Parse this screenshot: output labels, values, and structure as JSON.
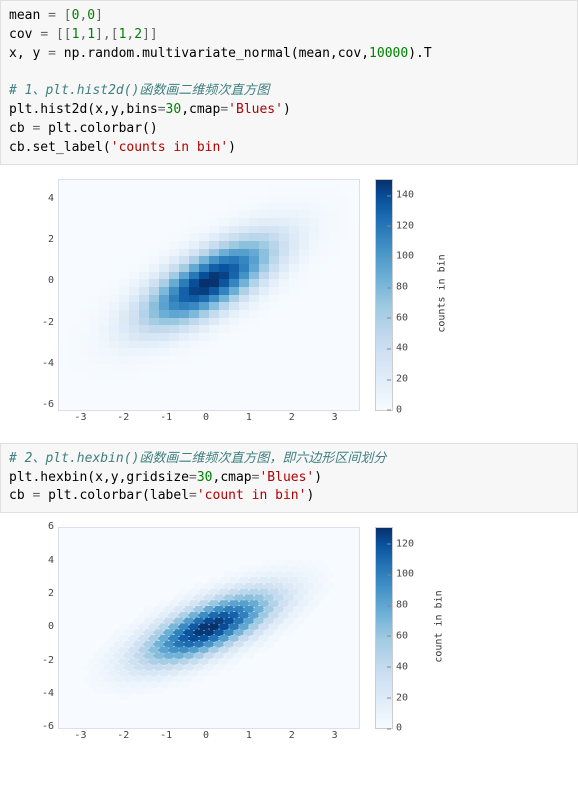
{
  "code_block_1": {
    "lines": [
      [
        [
          "mean ",
          "name"
        ],
        [
          "= ",
          "op"
        ],
        [
          "[",
          "op"
        ],
        [
          "0",
          "num"
        ],
        [
          ",",
          "op"
        ],
        [
          "0",
          "num"
        ],
        [
          "]",
          "op"
        ]
      ],
      [
        [
          "cov ",
          "name"
        ],
        [
          "= ",
          "op"
        ],
        [
          "[[",
          "op"
        ],
        [
          "1",
          "num"
        ],
        [
          ",",
          "op"
        ],
        [
          "1",
          "num"
        ],
        [
          "],[",
          "op"
        ],
        [
          "1",
          "num"
        ],
        [
          ",",
          "op"
        ],
        [
          "2",
          "num"
        ],
        [
          "]]",
          "op"
        ]
      ],
      [
        [
          "x, y ",
          "name"
        ],
        [
          "= ",
          "op"
        ],
        [
          "np.random.multivariate_normal(mean,cov,",
          "name"
        ],
        [
          "10000",
          "num"
        ],
        [
          ").T",
          "name"
        ]
      ],
      [
        [
          "",
          "name"
        ]
      ],
      [
        [
          "# 1、plt.hist2d()函数画二维频次直方图",
          "com"
        ]
      ],
      [
        [
          "plt.hist2d(x,y,bins",
          "name"
        ],
        [
          "=",
          "op"
        ],
        [
          "30",
          "num"
        ],
        [
          ",cmap",
          "name"
        ],
        [
          "=",
          "op"
        ],
        [
          "'Blues'",
          "str"
        ],
        [
          ")",
          "name"
        ]
      ],
      [
        [
          "cb ",
          "name"
        ],
        [
          "= ",
          "op"
        ],
        [
          "plt.colorbar()",
          "name"
        ]
      ],
      [
        [
          "cb.set_label(",
          "name"
        ],
        [
          "'counts in bin'",
          "str"
        ],
        [
          ")",
          "name"
        ]
      ]
    ]
  },
  "code_block_2": {
    "lines": [
      [
        [
          "# 2、plt.hexbin()函数画二维频次直方图，即六边形区间划分",
          "com"
        ]
      ],
      [
        [
          "plt.hexbin(x,y,gridsize",
          "name"
        ],
        [
          "=",
          "op"
        ],
        [
          "30",
          "num"
        ],
        [
          ",cmap",
          "name"
        ],
        [
          "=",
          "op"
        ],
        [
          "'Blues'",
          "str"
        ],
        [
          ")",
          "name"
        ]
      ],
      [
        [
          "cb ",
          "name"
        ],
        [
          "= ",
          "op"
        ],
        [
          "plt.colorbar(label",
          "name"
        ],
        [
          "=",
          "op"
        ],
        [
          "'count in bin'",
          "str"
        ],
        [
          ")",
          "name"
        ]
      ]
    ]
  },
  "chart_data": [
    {
      "type": "heatmap",
      "shape": "square-bins",
      "title": "",
      "xlabel": "",
      "ylabel": "",
      "xlim": [
        -3.5,
        3.5
      ],
      "ylim": [
        -6.2,
        5.0
      ],
      "x_ticks": [
        -3,
        -2,
        -1,
        0,
        1,
        2,
        3
      ],
      "y_ticks": [
        -6,
        -4,
        -2,
        0,
        2,
        4
      ],
      "bins": 30,
      "cmap": "Blues",
      "colorbar": {
        "label": "counts in bin",
        "range": [
          0,
          150
        ],
        "ticks": [
          0,
          20,
          40,
          60,
          80,
          100,
          120,
          140
        ]
      },
      "data_description": "2D histogram (30×30 bins) of 10000 samples from a bivariate normal with mean [0,0] and covariance [[1,1],[1,2]]. Density concentrated near origin along diagonal (positive slope). Cell value ≈ sample count in that bin; peak ≈ 150 near (0,0).",
      "peak_value": 150,
      "peak_location": [
        0,
        0
      ],
      "correlation_sign": "positive"
    },
    {
      "type": "heatmap",
      "shape": "hex-bins",
      "title": "",
      "xlabel": "",
      "ylabel": "",
      "xlim": [
        -3.5,
        3.5
      ],
      "ylim": [
        -6.0,
        6.0
      ],
      "x_ticks": [
        -3,
        -2,
        -1,
        0,
        1,
        2,
        3
      ],
      "y_ticks": [
        -6,
        -4,
        -2,
        0,
        2,
        4,
        6
      ],
      "gridsize": 30,
      "cmap": "Blues",
      "colorbar": {
        "label": "count in bin",
        "range": [
          0,
          130
        ],
        "ticks": [
          0,
          20,
          40,
          60,
          80,
          100,
          120
        ]
      },
      "data_description": "Hexbin plot (gridsize 30) of the same 10000 bivariate-normal samples. Density concentrated near origin along y≈x diagonal. Peak hex count ≈ 130 near (0,0).",
      "peak_value": 130,
      "peak_location": [
        0,
        0
      ],
      "correlation_sign": "positive"
    }
  ]
}
